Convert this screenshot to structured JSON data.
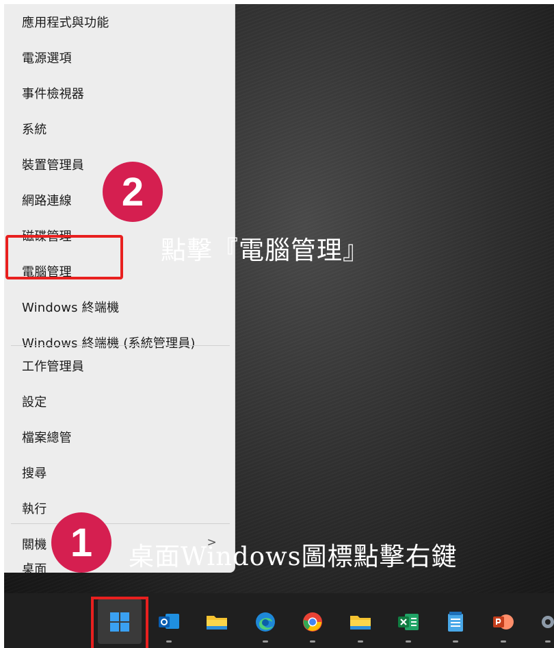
{
  "menu": {
    "items": [
      {
        "label": "應用程式與功能"
      },
      {
        "label": "電源選項"
      },
      {
        "label": "事件檢視器"
      },
      {
        "label": "系統"
      },
      {
        "label": "裝置管理員"
      },
      {
        "label": "網路連線"
      },
      {
        "label": "磁碟管理"
      },
      {
        "label": "電腦管理"
      },
      {
        "label": "Windows 終端機"
      },
      {
        "label": "Windows 終端機 (系統管理員)"
      },
      {
        "label": "工作管理員"
      },
      {
        "label": "設定"
      },
      {
        "label": "檔案總管"
      },
      {
        "label": "搜尋"
      },
      {
        "label": "執行"
      },
      {
        "label": "關機"
      },
      {
        "label": "桌面"
      }
    ],
    "shutdown_chevron": ">"
  },
  "annotations": {
    "step2_number": "2",
    "step2_text": "點擊『電腦管理』",
    "step1_number": "1",
    "step1_text": "桌面Windows圖標點擊右鍵"
  },
  "taskbar": {
    "icons": [
      {
        "name": "windows-start-icon"
      },
      {
        "name": "outlook-icon"
      },
      {
        "name": "file-explorer-icon"
      },
      {
        "name": "edge-icon"
      },
      {
        "name": "chrome-icon"
      },
      {
        "name": "file-explorer-icon-2"
      },
      {
        "name": "excel-icon"
      },
      {
        "name": "notepad-icon"
      },
      {
        "name": "powerpoint-icon"
      },
      {
        "name": "settings-icon"
      }
    ]
  },
  "colors": {
    "highlight": "#e8201f",
    "badge": "#d51f50",
    "menu_bg": "#ededed"
  }
}
